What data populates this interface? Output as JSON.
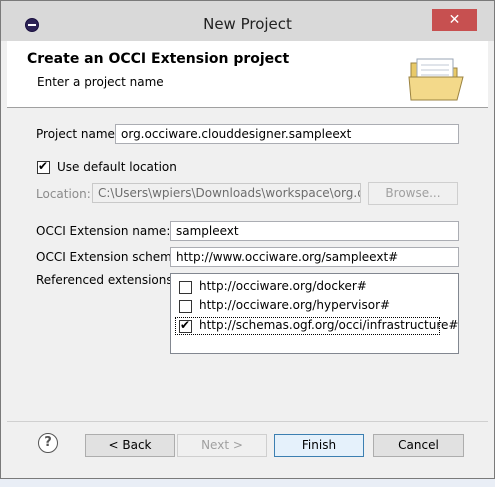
{
  "window": {
    "title": "New Project",
    "close_glyph": "✕"
  },
  "header": {
    "title": "Create an OCCI Extension project",
    "subtitle": "Enter a project name",
    "icon": "open-folder-icon"
  },
  "form": {
    "project_name_label": "Project name:",
    "project_name_value": "org.occiware.clouddesigner.sampleext",
    "use_default_location_label": "Use default location",
    "use_default_location_checked": true,
    "location_label": "Location:",
    "location_value": "C:\\Users\\wpiers\\Downloads\\workspace\\org.occiw",
    "browse_label": "Browse...",
    "extension_name_label": "OCCI Extension name:",
    "extension_name_value": "sampleext",
    "extension_scheme_label": "OCCI Extension scheme:",
    "extension_scheme_value": "http://www.occiware.org/sampleext#",
    "referenced_extensions_label": "Referenced extensions:",
    "referenced_extensions": [
      {
        "label": "http://occiware.org/docker#",
        "checked": false
      },
      {
        "label": "http://occiware.org/hypervisor#",
        "checked": false
      },
      {
        "label": "http://schemas.ogf.org/occi/infrastructure#",
        "checked": true
      }
    ]
  },
  "footer": {
    "help_glyph": "?",
    "back_label": "< Back",
    "next_label": "Next >",
    "finish_label": "Finish",
    "cancel_label": "Cancel"
  }
}
